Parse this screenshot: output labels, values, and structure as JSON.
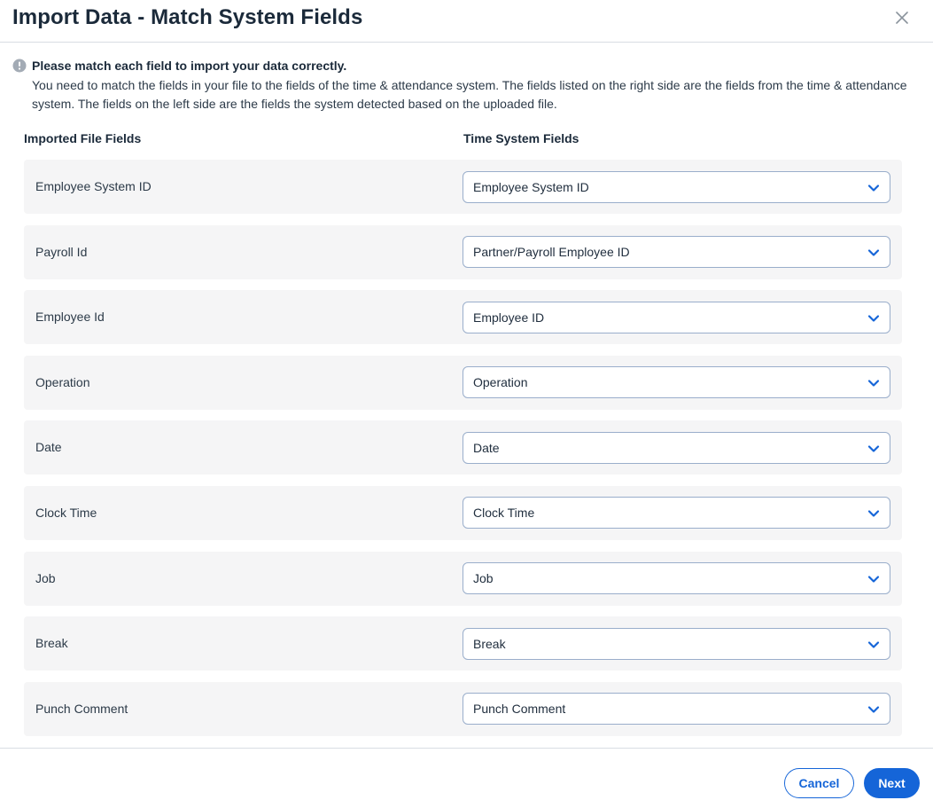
{
  "dialog": {
    "title": "Import Data - Match System Fields",
    "close_label": "×"
  },
  "notice": {
    "title": "Please match each field to import your data correctly.",
    "body": "You need to match the fields in your file to the fields of the time & attendance system. The fields listed on the right side are the fields from the time & attendance system. The fields on the left side are the fields the system detected based on the uploaded file."
  },
  "columns": {
    "left": "Imported File Fields",
    "right": "Time System Fields"
  },
  "rows": [
    {
      "label": "Employee System ID",
      "value": "Employee System ID"
    },
    {
      "label": "Payroll Id",
      "value": "Partner/Payroll Employee ID"
    },
    {
      "label": "Employee Id",
      "value": "Employee ID"
    },
    {
      "label": "Operation",
      "value": "Operation"
    },
    {
      "label": "Date",
      "value": "Date"
    },
    {
      "label": "Clock Time",
      "value": "Clock Time"
    },
    {
      "label": "Job",
      "value": "Job"
    },
    {
      "label": "Break",
      "value": "Break"
    },
    {
      "label": "Punch Comment",
      "value": "Punch Comment"
    }
  ],
  "footer": {
    "cancel_label": "Cancel",
    "next_label": "Next"
  },
  "icons": {
    "info": "info-icon",
    "close": "close-icon",
    "select_arrow": "chevron-down-icon"
  },
  "colors": {
    "accent": "#1565d8",
    "row_background": "#f5f5f6",
    "select_border": "#9aaecb"
  }
}
